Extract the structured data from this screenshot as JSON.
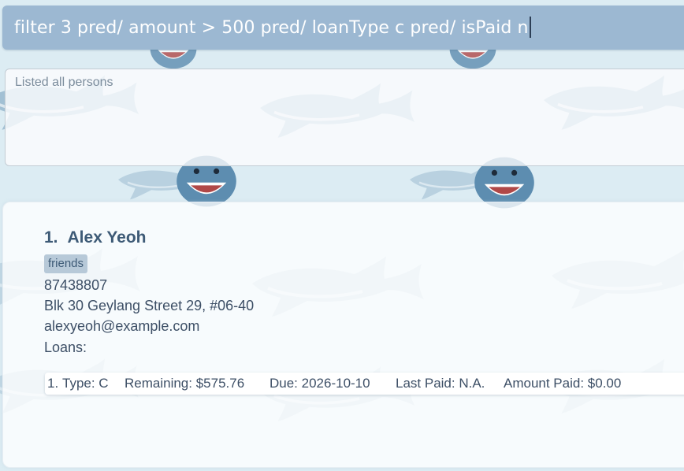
{
  "command_box": {
    "value": "filter 3 pred/ amount > 500 pred/ loanType c pred/ isPaid n"
  },
  "result_box": {
    "text": "Listed all persons"
  },
  "person_list": {
    "persons": [
      {
        "index": "1.",
        "name": "Alex Yeoh",
        "tags": [
          "friends"
        ],
        "phone": "87438807",
        "address": "Blk 30 Geylang Street 29, #06-40",
        "email": "alexyeoh@example.com",
        "loans_label": "Loans:",
        "loans": [
          {
            "index": "1.",
            "type": "Type: C",
            "remaining": "Remaining: $575.76",
            "due": "Due: 2026-10-10",
            "last_paid": "Last Paid: N.A.",
            "amount_paid": "Amount Paid: $0.00"
          }
        ]
      }
    ]
  },
  "colors": {
    "background": "#dcecf3",
    "command_box": "#9cb8d2",
    "name_text": "#3d5a76",
    "tag_bg": "#b7c9d8",
    "body_text": "#3d4f66"
  },
  "background_pattern": "shark-wallpaper"
}
